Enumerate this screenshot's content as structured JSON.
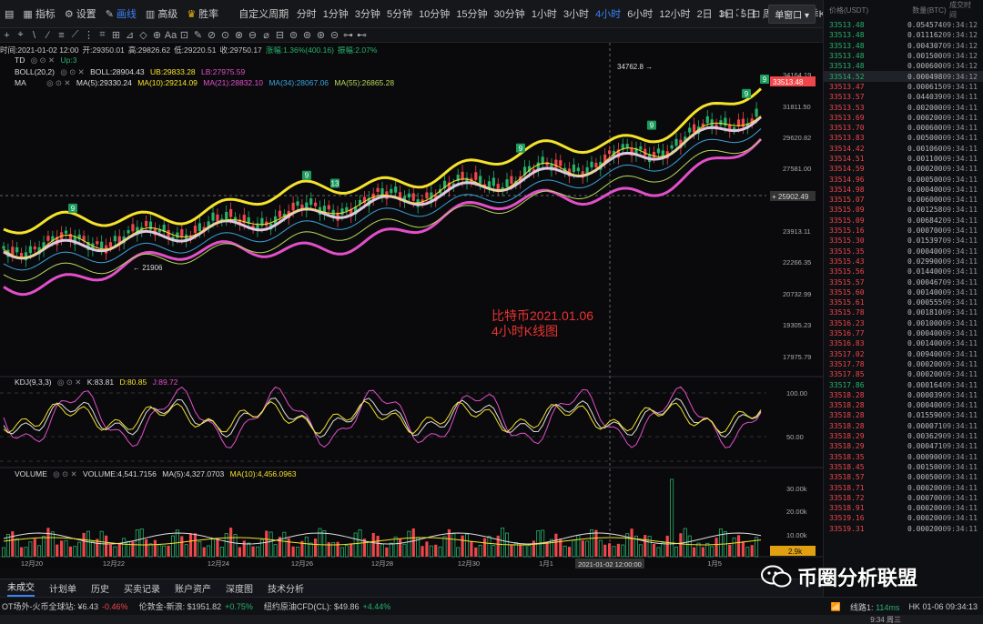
{
  "toolbar": {
    "items": [
      {
        "label": "指标",
        "icon": "chart-bars-icon"
      },
      {
        "label": "设置",
        "icon": "gear-icon"
      },
      {
        "label": "画线",
        "icon": "pen-icon"
      },
      {
        "label": "高级",
        "icon": "candle-icon"
      },
      {
        "label": "胜率",
        "icon": "trophy-icon"
      }
    ],
    "custom_period": "自定义周期",
    "periods": [
      "分时",
      "1分钟",
      "3分钟",
      "5分钟",
      "10分钟",
      "15分钟",
      "30分钟",
      "1小时",
      "3小时",
      "4小时",
      "6小时",
      "12小时",
      "2日",
      "3日",
      "5日",
      "周K",
      "月K",
      "季K",
      "1日"
    ],
    "active_period": "4小时",
    "right_label": "1s",
    "window_select": "单窗口"
  },
  "drawbar_icons": [
    "+",
    "⌖",
    "\\",
    "∕",
    "≡",
    "⟋",
    "⋮",
    "⌗",
    "⊞",
    "⊿",
    "◇",
    "⊕",
    "Aa",
    "⊡",
    "✎",
    "⊘",
    "⊙",
    "⊗",
    "⊖",
    "⌀",
    "⊟",
    "⊜",
    "⊚",
    "⊛",
    "⊝",
    "⊶",
    "⊷"
  ],
  "ohlc": {
    "time": "时间:2021-01-02 12:00",
    "open": "开:29350.01",
    "high": "高:29826.62",
    "low": "低:29220.51",
    "close": "收:29750.17",
    "change": "涨幅:1.36%(400.16)",
    "amplitude": "振幅:2.07%"
  },
  "indicators": {
    "td": {
      "name": "TD",
      "val": "Up:3"
    },
    "boll": {
      "name": "BOLL(20,2)",
      "boll": "BOLL:28904.43",
      "ub": "UB:29833.28",
      "lb": "LB:27975.59"
    },
    "ma": {
      "name": "MA",
      "ma5": "MA(5):29330.24",
      "ma10": "MA(10):29214.09",
      "ma21": "MA(21):28832.10",
      "ma34": "MA(34):28067.06",
      "ma55": "MA(55):26865.28"
    },
    "kdj": {
      "name": "KDJ(9,3,3)",
      "k": "K:83.81",
      "d": "D:80.85",
      "j": "J:89.72"
    },
    "volume": {
      "name": "VOLUME",
      "vol": "VOLUME:4,541.7156",
      "ma5": "MA(5):4,327.0703",
      "ma10": "MA(10):4,456.0963"
    }
  },
  "price_axis": {
    "ticks": [
      "34164.19",
      "31811.50",
      "29620.82",
      "27581.00",
      "25902.49",
      "23913.11",
      "22266.35",
      "20732.99",
      "19305.23",
      "17975.79"
    ],
    "current": "33513.48",
    "crosshair": "25902.49"
  },
  "kdj_axis": [
    "100.00",
    "50.00"
  ],
  "vol_axis": [
    "30.00k",
    "20.00k",
    "10.00k"
  ],
  "vol_current": "2.9k",
  "date_axis": [
    "12月20",
    "12月22",
    "12月24",
    "12月26",
    "12月28",
    "12月30",
    "1月1",
    "1月5"
  ],
  "crosshair_date": "2021-01-02 12:00:00",
  "annotations": {
    "high": "34762.8",
    "low": "21906"
  },
  "td_labels": [
    "9",
    "9",
    "13",
    "9",
    "9",
    "9",
    "9"
  ],
  "caption": {
    "line1": "比特币2021.01.06",
    "line2": "4小时K线图"
  },
  "colors": {
    "up": "#26b26b",
    "down": "#f0464a",
    "boll_mid": "#e0c8e0",
    "ub": "#f5e22a",
    "lb": "#e24fc9",
    "accent": "#3b82f6"
  },
  "chart_data": {
    "type": "candlestick",
    "title": "",
    "ylim": [
      17975.79,
      34164.19
    ],
    "x_labels": [
      "12月20",
      "12月22",
      "12月24",
      "12月26",
      "12月28",
      "12月30",
      "1月1",
      "1月5"
    ],
    "series": [
      {
        "name": "BOLL:28904.43"
      },
      {
        "name": "UB:29833.28"
      },
      {
        "name": "LB:27975.59"
      },
      {
        "name": "MA(5):29330.24"
      },
      {
        "name": "MA(10):29214.09"
      }
    ]
  },
  "bottom_tabs": [
    "未成交",
    "计划单",
    "历史",
    "买卖记录",
    "账户资产",
    "深度图",
    "技术分析"
  ],
  "ticker": [
    {
      "name": "OT场外-火币全球站",
      "price": "¥6.43",
      "chg": "-0.46%",
      "dir": "dn"
    },
    {
      "name": "伦敦金-新浪",
      "price": "$1951.82",
      "chg": "+0.75%",
      "dir": "up"
    },
    {
      "name": "纽约原油CFD(CL)",
      "price": "$49.86",
      "chg": "+4.44%",
      "dir": "up"
    }
  ],
  "status_right": {
    "line": "线路1:",
    "latency": "114ms",
    "clock": "HK 01-06 09:34:13"
  },
  "status_bar_time": "9:34 周三",
  "orderbook": {
    "headers": [
      "价格(USDT)",
      "数量(BTC)",
      "成交时间"
    ],
    "rows": [
      [
        "33513.48",
        "0.054574",
        "09:34:12",
        "buy"
      ],
      [
        "33513.48",
        "0.011162",
        "09:34:12",
        "buy"
      ],
      [
        "33513.48",
        "0.004307",
        "09:34:12",
        "buy"
      ],
      [
        "33513.48",
        "0.001500",
        "09:34:12",
        "buy"
      ],
      [
        "33513.48",
        "0.000600",
        "09:34:12",
        "buy"
      ],
      [
        "33514.52",
        "0.000498",
        "09:34:12",
        "hl"
      ],
      [
        "33513.47",
        "0.000615",
        "09:34:11",
        "sell"
      ],
      [
        "33513.57",
        "0.044039",
        "09:34:11",
        "sell"
      ],
      [
        "33513.53",
        "0.002000",
        "09:34:11",
        "sell"
      ],
      [
        "33513.69",
        "0.000200",
        "09:34:11",
        "sell"
      ],
      [
        "33513.70",
        "0.000600",
        "09:34:11",
        "sell"
      ],
      [
        "33513.83",
        "0.005000",
        "09:34:11",
        "sell"
      ],
      [
        "33514.42",
        "0.001060",
        "09:34:11",
        "sell"
      ],
      [
        "33514.51",
        "0.001100",
        "09:34:11",
        "sell"
      ],
      [
        "33514.59",
        "0.000200",
        "09:34:11",
        "sell"
      ],
      [
        "33514.96",
        "0.000500",
        "09:34:11",
        "sell"
      ],
      [
        "33514.98",
        "0.000400",
        "09:34:11",
        "sell"
      ],
      [
        "33515.07",
        "0.006000",
        "09:34:11",
        "sell"
      ],
      [
        "33515.09",
        "0.001258",
        "09:34:11",
        "sell"
      ],
      [
        "33515.09",
        "0.006842",
        "09:34:11",
        "sell"
      ],
      [
        "33515.16",
        "0.000700",
        "09:34:11",
        "sell"
      ],
      [
        "33515.30",
        "0.015397",
        "09:34:11",
        "sell"
      ],
      [
        "33515.35",
        "0.000400",
        "09:34:11",
        "sell"
      ],
      [
        "33515.43",
        "0.029900",
        "09:34:11",
        "sell"
      ],
      [
        "33515.56",
        "0.014400",
        "09:34:11",
        "sell"
      ],
      [
        "33515.57",
        "0.000467",
        "09:34:11",
        "sell"
      ],
      [
        "33515.60",
        "0.001400",
        "09:34:11",
        "sell"
      ],
      [
        "33515.61",
        "0.000555",
        "09:34:11",
        "sell"
      ],
      [
        "33515.78",
        "0.001810",
        "09:34:11",
        "sell"
      ],
      [
        "33516.23",
        "0.001000",
        "09:34:11",
        "sell"
      ],
      [
        "33516.77",
        "0.000400",
        "09:34:11",
        "sell"
      ],
      [
        "33516.83",
        "0.001400",
        "09:34:11",
        "sell"
      ],
      [
        "33517.02",
        "0.009400",
        "09:34:11",
        "sell"
      ],
      [
        "33517.78",
        "0.000200",
        "09:34:11",
        "sell"
      ],
      [
        "33517.85",
        "0.000200",
        "09:34:11",
        "sell"
      ],
      [
        "33517.86",
        "0.000164",
        "09:34:11",
        "buy"
      ],
      [
        "33518.28",
        "0.000039",
        "09:34:11",
        "sell"
      ],
      [
        "33518.28",
        "0.000400",
        "09:34:11",
        "sell"
      ],
      [
        "33518.28",
        "0.015590",
        "09:34:11",
        "sell"
      ],
      [
        "33518.28",
        "0.000071",
        "09:34:11",
        "sell"
      ],
      [
        "33518.29",
        "0.003629",
        "09:34:11",
        "sell"
      ],
      [
        "33518.29",
        "0.000471",
        "09:34:11",
        "sell"
      ],
      [
        "33518.35",
        "0.000900",
        "09:34:11",
        "sell"
      ],
      [
        "33518.45",
        "0.001500",
        "09:34:11",
        "sell"
      ],
      [
        "33518.57",
        "0.000500",
        "09:34:11",
        "sell"
      ],
      [
        "33518.71",
        "0.000200",
        "09:34:11",
        "sell"
      ],
      [
        "33518.72",
        "0.000700",
        "09:34:11",
        "sell"
      ],
      [
        "33518.91",
        "0.000200",
        "09:34:11",
        "sell"
      ],
      [
        "33519.16",
        "0.000200",
        "09:34:11",
        "sell"
      ],
      [
        "33519.31",
        "0.000200",
        "09:34:11",
        "sell"
      ]
    ]
  },
  "watermark": "币圈分析联盟"
}
